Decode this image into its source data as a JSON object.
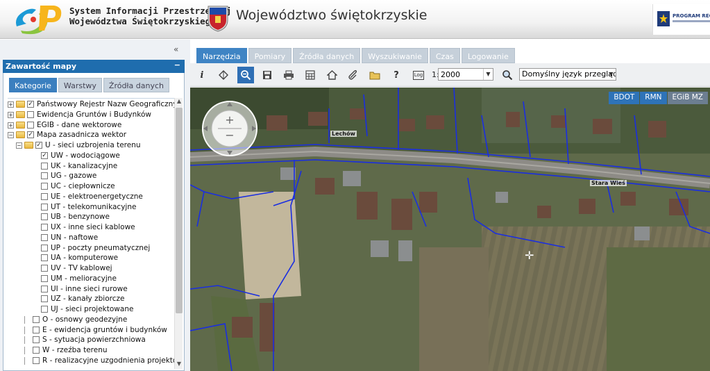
{
  "header": {
    "system_title_line1": "System Informacji Przestrzennej",
    "system_title_line2": "Województwa Świętokrzyskiego",
    "region_title": "Województwo świętokrzyskie",
    "program_logo_text": "PROGRAM REGIO"
  },
  "left_panel": {
    "collapse_icon": "«",
    "title": "Zawartość mapy",
    "minimize_icon": "−",
    "tabs": [
      "Kategorie",
      "Warstwy",
      "Źródła danych"
    ],
    "active_tab": "Kategorie",
    "tree": [
      {
        "label": "Państwowy Rejestr Nazw Geograficznych",
        "level": 0,
        "expander": "+",
        "folder": true,
        "checked": true
      },
      {
        "label": "Ewidencja Gruntów i Budynków",
        "level": 0,
        "expander": "+",
        "folder": true,
        "checked": false
      },
      {
        "label": "EGIB - dane wektorowe",
        "level": 0,
        "expander": "+",
        "folder": true,
        "checked": false
      },
      {
        "label": "Mapa zasadnicza wektor",
        "level": 0,
        "expander": "−",
        "folder": true,
        "checked": true
      },
      {
        "label": "U - sieci uzbrojenia terenu",
        "level": 1,
        "expander": "−",
        "folder": true,
        "checked": true
      },
      {
        "label": "UW - wodociągowe",
        "level": 2,
        "checked": true
      },
      {
        "label": "UK - kanalizacyjne",
        "level": 2,
        "checked": false
      },
      {
        "label": "UG - gazowe",
        "level": 2,
        "checked": false
      },
      {
        "label": "UC - ciepłownicze",
        "level": 2,
        "checked": false
      },
      {
        "label": "UE - elektroenergetyczne",
        "level": 2,
        "checked": false
      },
      {
        "label": "UT - telekomunikacyjne",
        "level": 2,
        "checked": false
      },
      {
        "label": "UB - benzynowe",
        "level": 2,
        "checked": false
      },
      {
        "label": "UX - inne sieci kablowe",
        "level": 2,
        "checked": false
      },
      {
        "label": "UN - naftowe",
        "level": 2,
        "checked": false
      },
      {
        "label": "UP - poczty pneumatycznej",
        "level": 2,
        "checked": false
      },
      {
        "label": "UA - komputerowe",
        "level": 2,
        "checked": false
      },
      {
        "label": "UV - TV kablowej",
        "level": 2,
        "checked": false
      },
      {
        "label": "UM - melioracyjne",
        "level": 2,
        "checked": false
      },
      {
        "label": "UI - inne sieci rurowe",
        "level": 2,
        "checked": false
      },
      {
        "label": "UZ - kanały zbiorcze",
        "level": 2,
        "checked": false
      },
      {
        "label": "UJ - sieci projektowane",
        "level": 2,
        "checked": false
      },
      {
        "label": "O - osnowy geodezyjne",
        "level": 1,
        "checked": false
      },
      {
        "label": "E - ewidencja gruntów i budynków",
        "level": 1,
        "checked": false
      },
      {
        "label": "S - sytuacja powierzchniowa",
        "level": 1,
        "checked": false
      },
      {
        "label": "W - rzeźba terenu",
        "level": 1,
        "checked": false
      },
      {
        "label": "R - realizacyjne uzgodnienia projektow",
        "level": 1,
        "checked": false
      }
    ]
  },
  "nav": {
    "tabs": [
      "Narzędzia",
      "Pomiary",
      "Źródła danych",
      "Wyszukiwanie",
      "Czas",
      "Logowanie"
    ],
    "active_tab": "Narzędzia"
  },
  "toolbar": {
    "icons": [
      "info-icon",
      "layers-icon",
      "zoom-window-icon",
      "save-icon",
      "print-icon",
      "calculator-icon",
      "home-icon",
      "attach-icon",
      "folder-icon",
      "help-icon",
      "log-icon"
    ],
    "log_label": "Log",
    "scale_prefix": "1:",
    "scale_value": "2000",
    "language_value": "Domyślny język przeglądar"
  },
  "map": {
    "layer_buttons": [
      "BDOT",
      "RMN",
      "EGiB MZ"
    ],
    "active_layer_buttons": [
      "BDOT",
      "RMN"
    ],
    "place_labels": [
      "Lechów",
      "Stara Wieś"
    ]
  }
}
